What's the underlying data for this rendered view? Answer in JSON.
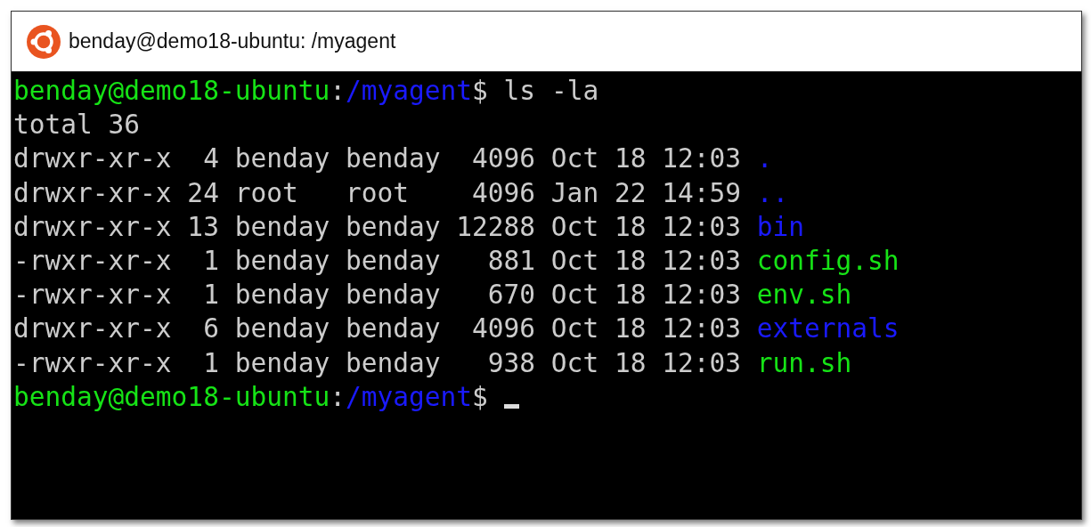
{
  "window": {
    "title": "benday@demo18-ubuntu: /myagent"
  },
  "terminal": {
    "lines": [
      {
        "kind": "prompt",
        "user_host": "benday@demo18-ubuntu",
        "separator": ":",
        "path": "/myagent",
        "symbol": "$",
        "command": " ls -la",
        "cursor": false
      },
      {
        "kind": "output",
        "text": "total 36"
      },
      {
        "kind": "listing",
        "meta": "drwxr-xr-x  4 benday benday  4096 Oct 18 12:03 ",
        "name": ".",
        "color": "#1a1aff"
      },
      {
        "kind": "listing",
        "meta": "drwxr-xr-x 24 root   root    4096 Jan 22 14:59 ",
        "name": "..",
        "color": "#1a1aff"
      },
      {
        "kind": "listing",
        "meta": "drwxr-xr-x 13 benday benday 12288 Oct 18 12:03 ",
        "name": "bin",
        "color": "#1a1aff"
      },
      {
        "kind": "listing",
        "meta": "-rwxr-xr-x  1 benday benday   881 Oct 18 12:03 ",
        "name": "config.sh",
        "color": "#16e316"
      },
      {
        "kind": "listing",
        "meta": "-rwxr-xr-x  1 benday benday   670 Oct 18 12:03 ",
        "name": "env.sh",
        "color": "#16e316"
      },
      {
        "kind": "listing",
        "meta": "drwxr-xr-x  6 benday benday  4096 Oct 18 12:03 ",
        "name": "externals",
        "color": "#1a1aff"
      },
      {
        "kind": "listing",
        "meta": "-rwxr-xr-x  1 benday benday   938 Oct 18 12:03 ",
        "name": "run.sh",
        "color": "#16e316"
      },
      {
        "kind": "prompt",
        "user_host": "benday@demo18-ubuntu",
        "separator": ":",
        "path": "/myagent",
        "symbol": "$",
        "cursor": true
      }
    ]
  }
}
